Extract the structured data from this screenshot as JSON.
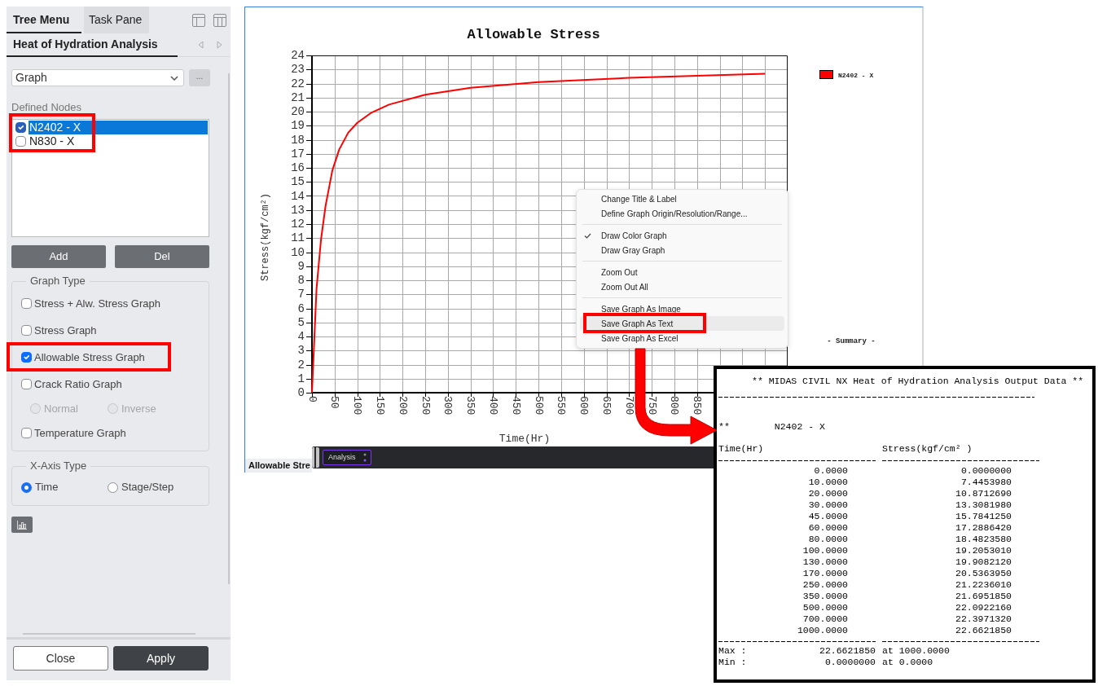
{
  "left_panel": {
    "tabs": [
      {
        "label": "Tree Menu",
        "selected": true
      },
      {
        "label": "Task Pane",
        "selected": false
      }
    ],
    "title": "Heat of Hydration Analysis",
    "mode_dropdown": {
      "value": "Graph"
    },
    "more_button": {
      "label": "...",
      "disabled": true
    },
    "defined_nodes": {
      "label": "Defined Nodes",
      "highlighted": true,
      "items": [
        {
          "label": "N2402 - X",
          "checked": true,
          "selected": true
        },
        {
          "label": "N830 - X",
          "checked": false,
          "selected": false
        }
      ]
    },
    "node_buttons": [
      {
        "label": "Add"
      },
      {
        "label": "Del"
      }
    ],
    "graph_type": {
      "title": "Graph Type",
      "options": [
        {
          "kind": "checkbox",
          "label": "Stress + Alw. Stress Graph",
          "checked": false,
          "highlighted": false
        },
        {
          "kind": "checkbox",
          "label": "Stress Graph",
          "checked": false,
          "highlighted": false
        },
        {
          "kind": "checkbox",
          "label": "Allowable Stress Graph",
          "checked": true,
          "highlighted": true
        },
        {
          "kind": "checkbox",
          "label": "Crack Ratio Graph",
          "checked": false,
          "highlighted": false
        },
        {
          "kind": "radios",
          "options": [
            {
              "label": "Normal",
              "selected": false,
              "disabled": true
            },
            {
              "label": "Inverse",
              "selected": false,
              "disabled": true
            }
          ]
        },
        {
          "kind": "checkbox",
          "label": "Temperature Graph",
          "checked": false,
          "highlighted": false
        }
      ]
    },
    "x_axis_type": {
      "title": "X-Axis Type",
      "options": [
        {
          "label": "Time",
          "selected": true
        },
        {
          "label": "Stage/Step",
          "selected": false
        }
      ]
    },
    "footer_buttons": [
      {
        "label": "Close",
        "kind": "outline"
      },
      {
        "label": "Apply",
        "kind": "solid"
      }
    ]
  },
  "chart_window": {
    "chart_data": {
      "type": "line",
      "title": "Allowable Stress",
      "xlabel": "Time(Hr)",
      "ylabel": "Stress(kgf/cm²)",
      "x": [
        0,
        10,
        20,
        30,
        45,
        60,
        80,
        100,
        130,
        170,
        250,
        350,
        500,
        700,
        1000
      ],
      "series": [
        {
          "name": "N2402 - X",
          "color": "#ff0000",
          "values": [
            0,
            7.4,
            10.9,
            13.3,
            15.8,
            17.3,
            18.5,
            19.2,
            19.9,
            20.5,
            21.2,
            21.7,
            22.1,
            22.4,
            22.7
          ]
        }
      ],
      "xlim": [
        0,
        1050
      ],
      "ylim": [
        0,
        24
      ],
      "xticks": [
        0,
        50,
        100,
        150,
        200,
        250,
        300,
        350,
        400,
        450,
        500,
        550,
        600,
        650,
        700,
        750,
        800,
        850
      ],
      "yticks": [
        0,
        1,
        2,
        3,
        4,
        5,
        6,
        7,
        8,
        9,
        10,
        11,
        12,
        13,
        14,
        15,
        16,
        17,
        18,
        19,
        20,
        21,
        22,
        23,
        24
      ],
      "grid": true
    },
    "summary_label": "- Summary -",
    "tab": {
      "label": "Allowable Stre",
      "selected": true
    },
    "toolbar": {
      "dropdown": "Analysis"
    }
  },
  "context_menu": {
    "groups": [
      {
        "items": [
          {
            "label": "Change Title & Label",
            "checked": false,
            "selected": false,
            "highlighted": false
          },
          {
            "label": "Define Graph Origin/Resolution/Range...",
            "checked": false,
            "selected": false,
            "highlighted": false
          }
        ]
      },
      {
        "items": [
          {
            "label": "Draw Color Graph",
            "checked": true,
            "selected": false,
            "highlighted": false
          },
          {
            "label": "Draw Gray Graph",
            "checked": false,
            "selected": false,
            "highlighted": false
          }
        ]
      },
      {
        "items": [
          {
            "label": "Zoom Out",
            "checked": false,
            "selected": false,
            "highlighted": false
          },
          {
            "label": "Zoom Out All",
            "checked": false,
            "selected": false,
            "highlighted": false
          }
        ]
      },
      {
        "items": [
          {
            "label": "Save Graph As Image",
            "checked": false,
            "selected": false,
            "highlighted": false
          },
          {
            "label": "Save Graph As Text",
            "checked": false,
            "selected": true,
            "highlighted": true
          },
          {
            "label": "Save Graph As Excel",
            "checked": false,
            "selected": false,
            "highlighted": false
          }
        ]
      }
    ]
  },
  "output_text": {
    "title": "** MIDAS CIVIL NX Heat of Hydration Analysis Output Data **",
    "node_marker": "**",
    "node": "N2402 - X",
    "columns": [
      "Time(Hr)",
      "Stress(kgf/cm² )"
    ],
    "rows": [
      {
        "time": "0.0000",
        "stress": "0.0000000"
      },
      {
        "time": "10.0000",
        "stress": "7.4453980"
      },
      {
        "time": "20.0000",
        "stress": "10.8712690"
      },
      {
        "time": "30.0000",
        "stress": "13.3081980"
      },
      {
        "time": "45.0000",
        "stress": "15.7841250"
      },
      {
        "time": "60.0000",
        "stress": "17.2886420"
      },
      {
        "time": "80.0000",
        "stress": "18.4823580"
      },
      {
        "time": "100.0000",
        "stress": "19.2053010"
      },
      {
        "time": "130.0000",
        "stress": "19.9082120"
      },
      {
        "time": "170.0000",
        "stress": "20.5363950"
      },
      {
        "time": "250.0000",
        "stress": "21.2236010"
      },
      {
        "time": "350.0000",
        "stress": "21.6951850"
      },
      {
        "time": "500.0000",
        "stress": "22.0922160"
      },
      {
        "time": "700.0000",
        "stress": "22.3971320"
      },
      {
        "time": "1000.0000",
        "stress": "22.6621850"
      }
    ],
    "summary": [
      {
        "label": "Max :",
        "value": "22.6621850",
        "at": "at 1000.0000"
      },
      {
        "label": "Min :",
        "value": "0.0000000",
        "at": "at 0.0000"
      }
    ]
  }
}
